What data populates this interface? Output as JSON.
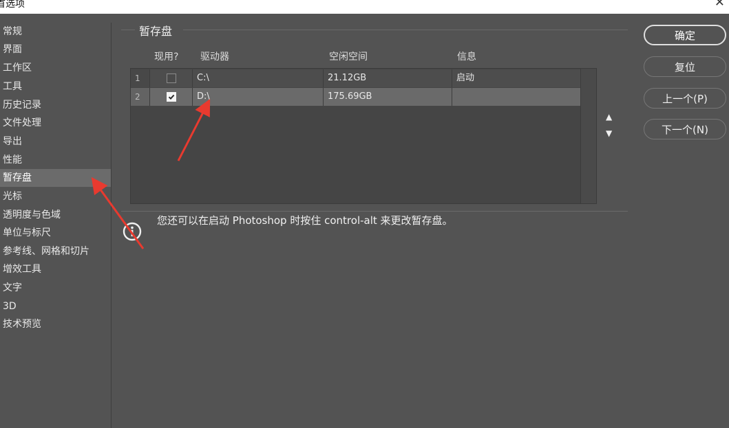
{
  "window": {
    "title": "首选项",
    "close_glyph": "✕"
  },
  "sidebar": {
    "items": [
      {
        "label": "常规"
      },
      {
        "label": "界面"
      },
      {
        "label": "工作区"
      },
      {
        "label": "工具"
      },
      {
        "label": "历史记录"
      },
      {
        "label": "文件处理"
      },
      {
        "label": "导出"
      },
      {
        "label": "性能"
      },
      {
        "label": "暂存盘",
        "selected": true
      },
      {
        "label": "光标"
      },
      {
        "label": "透明度与色域"
      },
      {
        "label": "单位与标尺"
      },
      {
        "label": "参考线、网格和切片"
      },
      {
        "label": "增效工具"
      },
      {
        "label": "文字"
      },
      {
        "label": "3D"
      },
      {
        "label": "技术预览"
      }
    ]
  },
  "scratch": {
    "group_title": "暂存盘",
    "columns": {
      "active": "现用?",
      "drive": "驱动器",
      "free": "空闲空间",
      "info": "信息"
    },
    "rows": [
      {
        "index": "1",
        "checked": false,
        "drive": "C:\\",
        "free": "21.12GB",
        "info": "启动"
      },
      {
        "index": "2",
        "checked": true,
        "drive": "D:\\",
        "free": "175.69GB",
        "info": ""
      }
    ],
    "move_up": "▲",
    "move_down": "▼"
  },
  "info": {
    "message": "您还可以在启动 Photoshop 时按住 control-alt 来更改暂存盘。"
  },
  "buttons": {
    "ok": "确定",
    "reset": "复位",
    "prev": "上一个(P)",
    "next": "下一个(N)"
  },
  "colors": {
    "background": "#535353",
    "selected": "#6b6b6b",
    "annotation_arrow": "#e83a2f"
  }
}
